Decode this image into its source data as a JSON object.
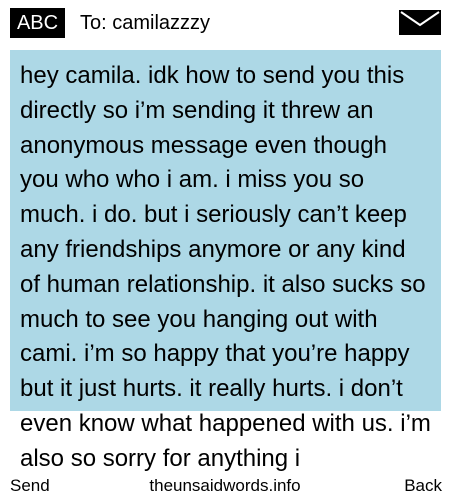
{
  "header": {
    "mode_badge": "ABC",
    "recipient": "To: camilazzzy",
    "icon": "envelope-icon"
  },
  "message": {
    "text": "hey camila. idk how to send you this directly so i’m sending it threw an anonymous message even though you who who i am. i miss you so much. i do. but i seriously can’t keep any friendships anymore or any kind of human relationship. it also sucks so much to see you hanging out with cami. i’m so happy that you’re happy but it just hurts. it really hurts. i don’t even know what happened with us. i’m also so sorry for anything i",
    "highlight_color": "#add8e6"
  },
  "footer": {
    "left_softkey": "Send",
    "site": "theunsaidwords.info",
    "right_softkey": "Back"
  }
}
